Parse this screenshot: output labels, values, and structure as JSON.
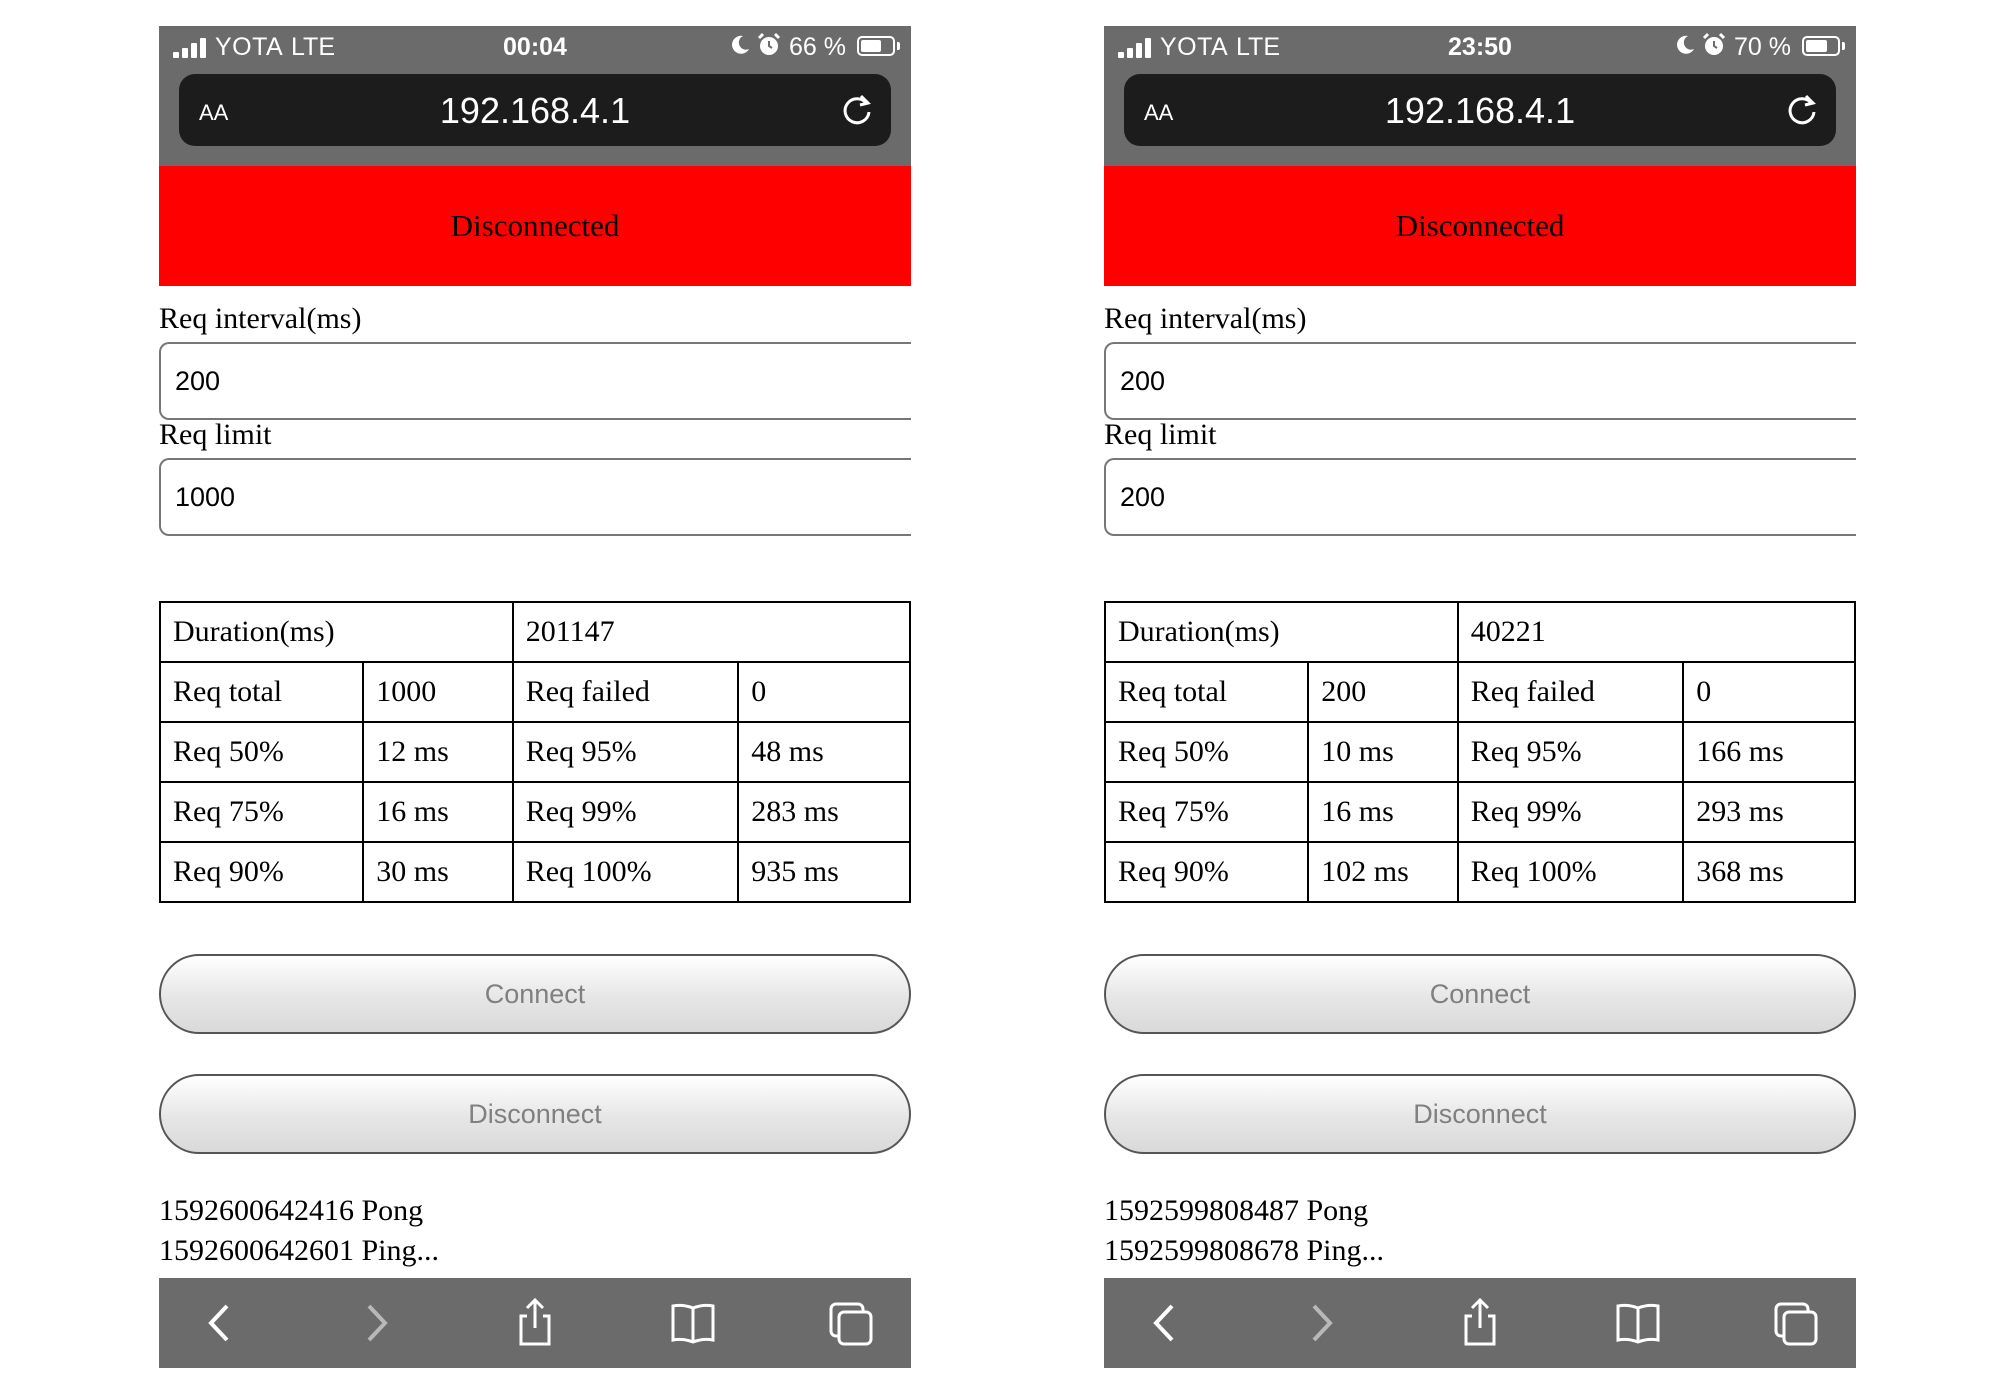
{
  "phones": [
    {
      "status": {
        "carrier": "YOTA",
        "network": "LTE",
        "time": "00:04",
        "battery": "66 %",
        "battery_level": 0.66
      },
      "address": {
        "aa": "AA",
        "url": "192.168.4.1"
      },
      "banner": "Disconnected",
      "form": {
        "interval_label": "Req interval(ms)",
        "interval_value": "200",
        "limit_label": "Req limit",
        "limit_value": "1000"
      },
      "stats": {
        "duration_label": "Duration(ms)",
        "duration_value": "201147",
        "rows": [
          [
            "Req total",
            "1000",
            "Req failed",
            "0"
          ],
          [
            "Req 50%",
            "12 ms",
            "Req 95%",
            "48 ms"
          ],
          [
            "Req 75%",
            "16 ms",
            "Req 99%",
            "283 ms"
          ],
          [
            "Req 90%",
            "30 ms",
            "Req 100%",
            "935 ms"
          ]
        ]
      },
      "buttons": {
        "connect": "Connect",
        "disconnect": "Disconnect"
      },
      "log": [
        "1592600642416 Pong",
        "1592600642601 Ping..."
      ]
    },
    {
      "status": {
        "carrier": "YOTA",
        "network": "LTE",
        "time": "23:50",
        "battery": "70 %",
        "battery_level": 0.7
      },
      "address": {
        "aa": "AA",
        "url": "192.168.4.1"
      },
      "banner": "Disconnected",
      "form": {
        "interval_label": "Req interval(ms)",
        "interval_value": "200",
        "limit_label": "Req limit",
        "limit_value": "200"
      },
      "stats": {
        "duration_label": "Duration(ms)",
        "duration_value": "40221",
        "rows": [
          [
            "Req total",
            "200",
            "Req failed",
            "0"
          ],
          [
            "Req 50%",
            "10 ms",
            "Req 95%",
            "166 ms"
          ],
          [
            "Req 75%",
            "16 ms",
            "Req 99%",
            "293 ms"
          ],
          [
            "Req 90%",
            "102 ms",
            "Req 100%",
            "368 ms"
          ]
        ]
      },
      "buttons": {
        "connect": "Connect",
        "disconnect": "Disconnect"
      },
      "log": [
        "1592599808487 Pong",
        "1592599808678 Ping..."
      ]
    }
  ],
  "icons": {
    "status": [
      "signal-icon",
      "moon-icon",
      "alarm-icon",
      "battery-icon"
    ],
    "address": [
      "reload-icon"
    ],
    "toolbar": [
      "back-icon",
      "forward-icon",
      "share-icon",
      "bookmarks-icon",
      "tabs-icon"
    ]
  },
  "colors": {
    "banner": "#ff0000",
    "chrome": "#6b6b6b",
    "address_bar": "#1c1c1c"
  }
}
